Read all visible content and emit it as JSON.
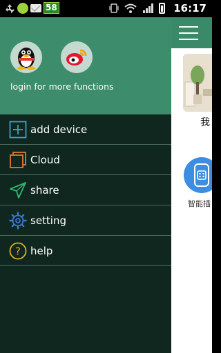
{
  "status_bar": {
    "badge": "58",
    "time": "16:17"
  },
  "drawer": {
    "login_text": "login for more functions",
    "menu": [
      {
        "label": "add device",
        "icon": "add-box-icon",
        "color": "#3aa0d0"
      },
      {
        "label": "Cloud",
        "icon": "copy-squares-icon",
        "color": "#e07a33"
      },
      {
        "label": "share",
        "icon": "paper-plane-icon",
        "color": "#2fb873"
      },
      {
        "label": "setting",
        "icon": "gear-icon",
        "color": "#3a7ad0"
      },
      {
        "label": "help",
        "icon": "question-circle-icon",
        "color": "#e0b020"
      }
    ]
  },
  "main": {
    "card_label": "我",
    "device_label": "智能插"
  },
  "colors": {
    "header": "#3d8d6c",
    "drawer_bg": "#0f271f",
    "topbar": "#3a8a6a"
  }
}
